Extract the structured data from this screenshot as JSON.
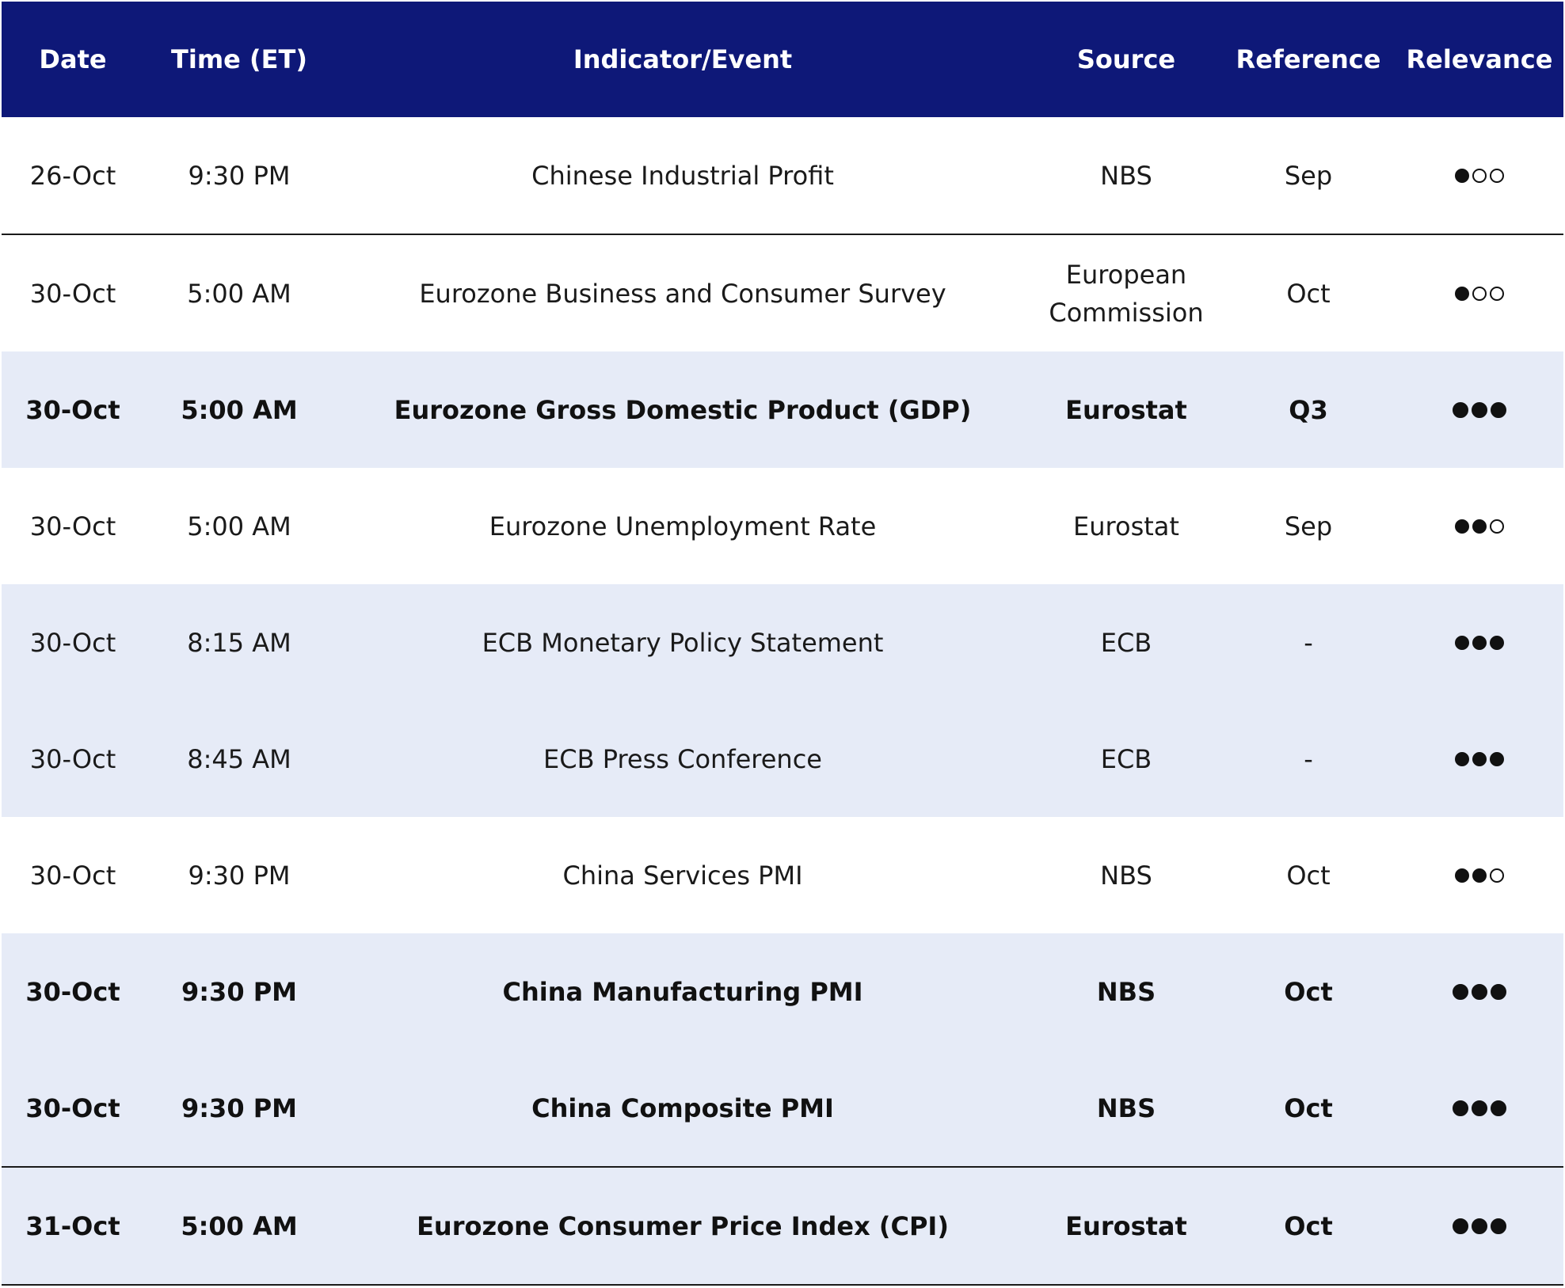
{
  "columns": {
    "date": "Date",
    "time": "Time (ET)",
    "event": "Indicator/Event",
    "source": "Source",
    "reference": "Reference",
    "relevance": "Relevance"
  },
  "colors": {
    "header_bg": "#0e1878",
    "row_shade": "#e6ebf7"
  },
  "rows": [
    {
      "date": "26-Oct",
      "time": "9:30 PM",
      "event": "Chinese Industrial Profit",
      "source": "NBS",
      "reference": "Sep",
      "relevance": 1,
      "bold": false,
      "shaded": false
    },
    {
      "date": "30-Oct",
      "time": "5:00 AM",
      "event": "Eurozone Business and Consumer Survey",
      "source": "European Commission",
      "reference": "Oct",
      "relevance": 1,
      "bold": false,
      "shaded": false
    },
    {
      "date": "30-Oct",
      "time": "5:00 AM",
      "event": "Eurozone Gross Domestic Product (GDP)",
      "source": "Eurostat",
      "reference": "Q3",
      "relevance": 3,
      "bold": true,
      "shaded": true
    },
    {
      "date": "30-Oct",
      "time": "5:00 AM",
      "event": "Eurozone Unemployment Rate",
      "source": "Eurostat",
      "reference": "Sep",
      "relevance": 2,
      "bold": false,
      "shaded": false
    },
    {
      "date": "30-Oct",
      "time": "8:15 AM",
      "event": "ECB Monetary Policy Statement",
      "source": "ECB",
      "reference": "-",
      "relevance": 3,
      "bold": false,
      "shaded": true
    },
    {
      "date": "30-Oct",
      "time": "8:45 AM",
      "event": "ECB Press Conference",
      "source": "ECB",
      "reference": "-",
      "relevance": 3,
      "bold": false,
      "shaded": true
    },
    {
      "date": "30-Oct",
      "time": "9:30 PM",
      "event": "China Services PMI",
      "source": "NBS",
      "reference": "Oct",
      "relevance": 2,
      "bold": false,
      "shaded": false
    },
    {
      "date": "30-Oct",
      "time": "9:30 PM",
      "event": "China Manufacturing PMI",
      "source": "NBS",
      "reference": "Oct",
      "relevance": 3,
      "bold": true,
      "shaded": true
    },
    {
      "date": "30-Oct",
      "time": "9:30 PM",
      "event": "China Composite PMI",
      "source": "NBS",
      "reference": "Oct",
      "relevance": 3,
      "bold": true,
      "shaded": true
    },
    {
      "date": "31-Oct",
      "time": "5:00 AM",
      "event": "Eurozone Consumer Price Index (CPI)",
      "source": "Eurostat",
      "reference": "Oct",
      "relevance": 3,
      "bold": true,
      "shaded": true
    }
  ]
}
